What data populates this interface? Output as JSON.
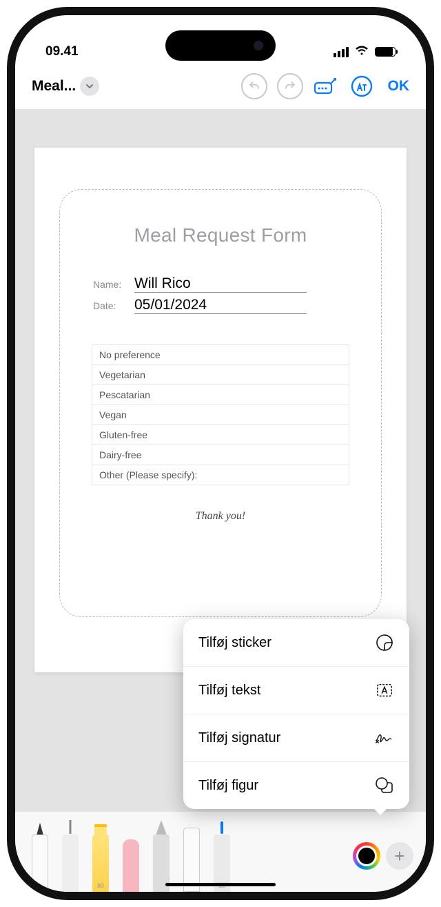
{
  "status": {
    "time": "09.41"
  },
  "toolbar": {
    "title": "Meal...",
    "ok": "OK"
  },
  "document": {
    "form_title": "Meal Request Form",
    "name_label": "Name:",
    "name_value": "Will Rico",
    "date_label": "Date:",
    "date_value": "05/01/2024",
    "options": [
      "No preference",
      "Vegetarian",
      "Pescatarian",
      "Vegan",
      "Gluten-free",
      "Dairy-free",
      "Other (Please specify):"
    ],
    "thanks": "Thank you!"
  },
  "popup": {
    "items": [
      {
        "label": "Tilføj sticker",
        "icon": "sticker"
      },
      {
        "label": "Tilføj tekst",
        "icon": "textbox"
      },
      {
        "label": "Tilføj signatur",
        "icon": "signature"
      },
      {
        "label": "Tilføj figur",
        "icon": "shape"
      }
    ]
  },
  "tools": {
    "highlighter_size": "80",
    "blue_pen_size": "50"
  }
}
